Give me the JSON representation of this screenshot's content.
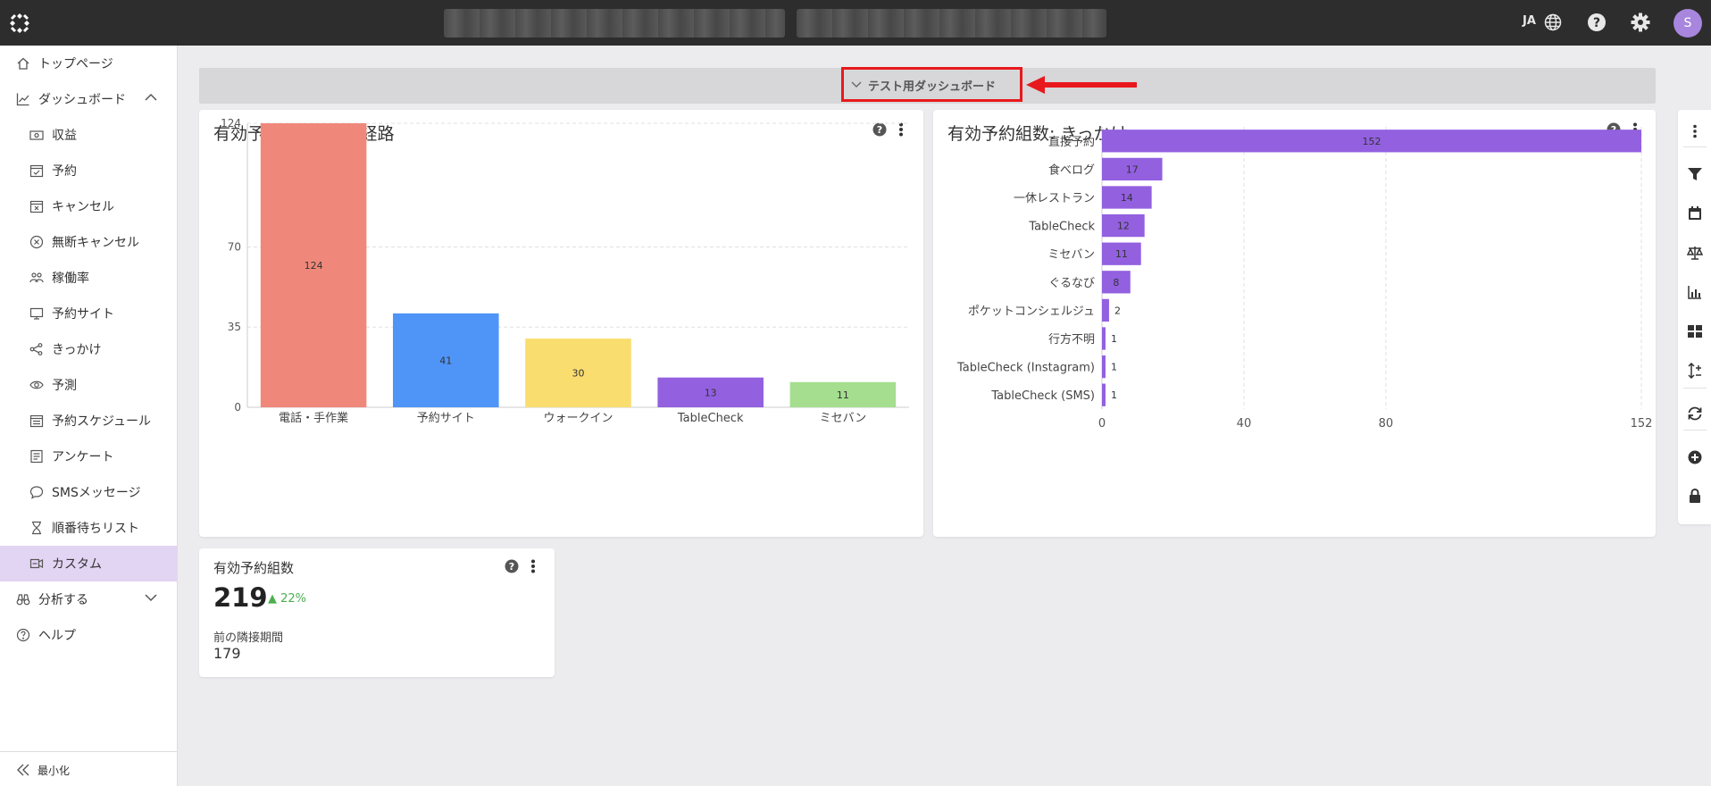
{
  "topbar": {
    "lang": "JA",
    "avatar_initial": "S"
  },
  "sidebar": {
    "items": [
      {
        "label": "トップページ",
        "icon": "home-icon",
        "level": "top"
      },
      {
        "label": "ダッシュボード",
        "icon": "chart-line-icon",
        "level": "top",
        "expanded": true
      },
      {
        "label": "収益",
        "icon": "money-icon",
        "level": "sub"
      },
      {
        "label": "予約",
        "icon": "calendar-check-icon",
        "level": "sub"
      },
      {
        "label": "キャンセル",
        "icon": "calendar-x-icon",
        "level": "sub"
      },
      {
        "label": "無断キャンセル",
        "icon": "circle-x-icon",
        "level": "sub"
      },
      {
        "label": "稼働率",
        "icon": "people-icon",
        "level": "sub"
      },
      {
        "label": "予約サイト",
        "icon": "monitor-icon",
        "level": "sub"
      },
      {
        "label": "きっかけ",
        "icon": "share-icon",
        "level": "sub"
      },
      {
        "label": "予測",
        "icon": "eye-icon",
        "level": "sub"
      },
      {
        "label": "予約スケジュール",
        "icon": "schedule-icon",
        "level": "sub"
      },
      {
        "label": "アンケート",
        "icon": "survey-icon",
        "level": "sub"
      },
      {
        "label": "SMSメッセージ",
        "icon": "chat-icon",
        "level": "sub"
      },
      {
        "label": "順番待ちリスト",
        "icon": "hourglass-icon",
        "level": "sub"
      },
      {
        "label": "カスタム",
        "icon": "custom-icon",
        "level": "sub",
        "active": true
      },
      {
        "label": "分析する",
        "icon": "binoculars-icon",
        "level": "top",
        "expanded": false
      },
      {
        "label": "ヘルプ",
        "icon": "help-circle-icon",
        "level": "top"
      }
    ],
    "minimize_label": "最小化"
  },
  "dashboard": {
    "title": "テスト用ダッシュボード"
  },
  "card1": {
    "title": "有効予約組数: 主要経路"
  },
  "card2": {
    "title": "有効予約組数: きっかけ"
  },
  "kpi": {
    "title": "有効予約組数",
    "value": "219",
    "delta": "22%",
    "prev_label": "前の隣接期間",
    "prev_value": "179"
  },
  "colors": {
    "accent": "#a886dd",
    "active_bg": "#e2d4f3",
    "highlight_box": "#e8191d",
    "bar_purple": "#9360e0"
  },
  "chart_data": [
    {
      "type": "bar",
      "title": "有効予約組数: 主要経路",
      "categories": [
        "電話・手作業",
        "予約サイト",
        "ウォークイン",
        "TableCheck",
        "ミセバン"
      ],
      "values": [
        124,
        41,
        30,
        13,
        11
      ],
      "colors": [
        "#ef887a",
        "#4f95f7",
        "#f9dd6f",
        "#9360e0",
        "#a4de8e"
      ],
      "yticks": [
        0,
        35,
        70,
        124
      ],
      "ylim": [
        0,
        124
      ],
      "grid": true
    },
    {
      "type": "bar",
      "orientation": "horizontal",
      "title": "有効予約組数: きっかけ",
      "categories": [
        "直接予約",
        "食べログ",
        "一休レストラン",
        "TableCheck",
        "ミセバン",
        "ぐるなび",
        "ポケットコンシェルジュ",
        "行方不明",
        "TableCheck (Instagram)",
        "TableCheck (SMS)"
      ],
      "values": [
        152,
        17,
        14,
        12,
        11,
        8,
        2,
        1,
        1,
        1
      ],
      "color": "#9360e0",
      "xticks": [
        0,
        40,
        80,
        152
      ],
      "xlim": [
        0,
        152
      ],
      "grid": true
    }
  ]
}
